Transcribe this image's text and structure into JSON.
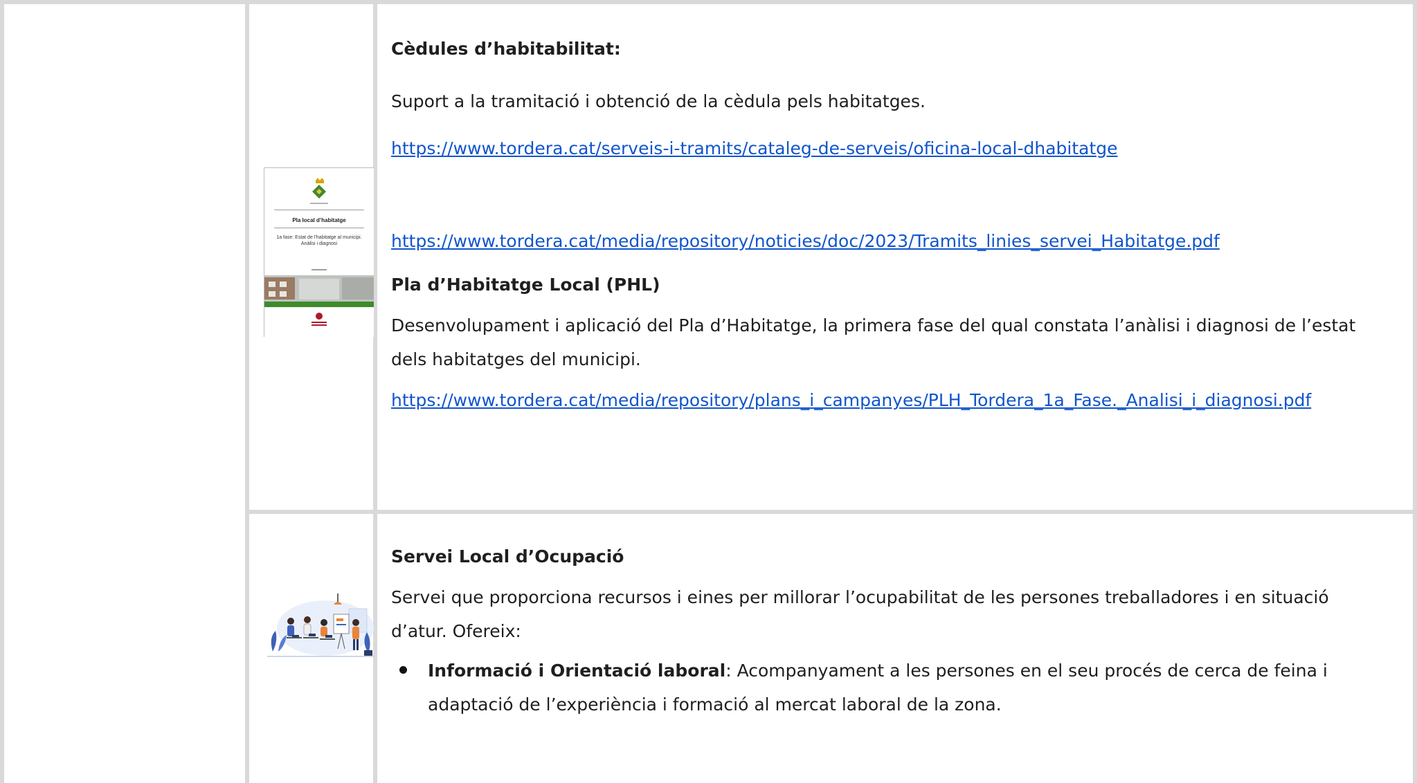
{
  "housing": {
    "cedules": {
      "title": "Cèdules d’habitabilitat:",
      "description": "Suport a la tramitació i obtenció de la cèdula pels habitatges.",
      "link1": "https://www.tordera.cat/serveis-i-tramits/cataleg-de-serveis/oficina-local-dhabitatge",
      "link2": "https://www.tordera.cat/media/repository/noticies/doc/2023/Tramits_linies_servei_Habitatge.pdf"
    },
    "phl": {
      "title": "Pla d’Habitatge Local (PHL)",
      "description": "Desenvolupament i aplicació del Pla d’Habitatge, la primera fase del qual constata l’anàlisi i diagnosi de l’estat dels habitatges del municipi.",
      "link": "https://www.tordera.cat/media/repository/plans_i_campanyes/PLH_Tordera_1a_Fase._Analisi_i_diagnosi.pdf"
    },
    "thumbnail": {
      "title": "Pla local d’habitatge",
      "subtitle": "1a fase: Estat de l’habitatge al municipi. Anàlisi i diagnosi"
    }
  },
  "employment": {
    "title": "Servei Local d’Ocupació",
    "description": "Servei que proporciona recursos i eines per millorar l’ocupabilitat de les persones treballadores i en situació d’atur. Ofereix:",
    "bullets": [
      {
        "label": "Informació i Orientació laboral",
        "text": ": Acompanyament a les persones en el seu procés de cerca de feina i adaptació de l’experiència i formació al mercat laboral de la zona."
      }
    ]
  },
  "colors": {
    "link": "#1155cc",
    "border": "#d9d9d9",
    "thumbnail_green": "#3f8a2b",
    "thumbnail_red": "#b0182b"
  }
}
